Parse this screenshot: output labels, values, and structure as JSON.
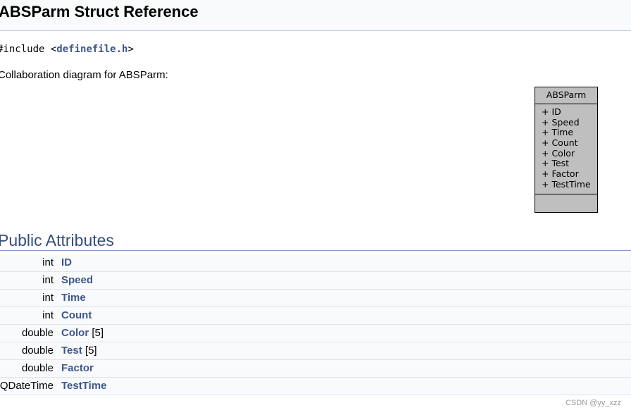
{
  "header": {
    "title": "ABSParm Struct Reference"
  },
  "include": {
    "prefix": "#include <",
    "file": "definefile.h",
    "suffix": ">"
  },
  "collaboration_label": "Collaboration diagram for ABSParm:",
  "diagram": {
    "class_name": "ABSParm",
    "attributes": [
      "+ ID",
      "+ Speed",
      "+ Time",
      "+ Count",
      "+ Color",
      "+ Test",
      "+ Factor",
      "+ TestTime"
    ]
  },
  "section": {
    "title": "Public Attributes"
  },
  "members": [
    {
      "type": "int",
      "name": "ID",
      "suffix": ""
    },
    {
      "type": "int",
      "name": "Speed",
      "suffix": ""
    },
    {
      "type": "int",
      "name": "Time",
      "suffix": ""
    },
    {
      "type": "int",
      "name": "Count",
      "suffix": ""
    },
    {
      "type": "double",
      "name": "Color",
      "suffix": " [5]"
    },
    {
      "type": "double",
      "name": "Test",
      "suffix": " [5]"
    },
    {
      "type": "double",
      "name": "Factor",
      "suffix": ""
    },
    {
      "type": "QDateTime",
      "name": "TestTime",
      "suffix": ""
    }
  ],
  "watermark": "CSDN @yy_xzz",
  "colors": {
    "link": "#3d578c",
    "section_title": "#354c7b",
    "diagram_fill": "#bfbfbf"
  }
}
